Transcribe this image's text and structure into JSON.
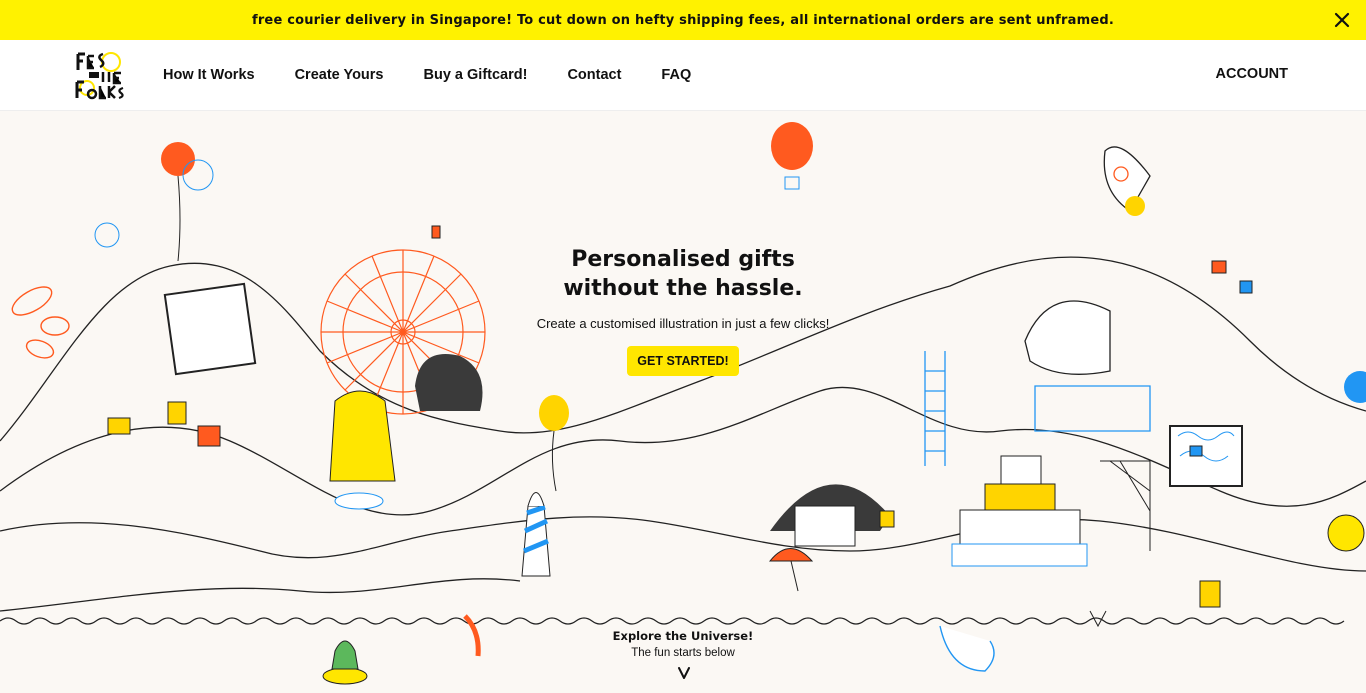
{
  "announcement": {
    "text": "free courier delivery in Singapore! To cut down on hefty shipping fees, all international orders are sent unframed.",
    "close_icon": "close-icon"
  },
  "header": {
    "logo_icon": "festive-folks-logo-icon",
    "nav": [
      {
        "label": "How It Works"
      },
      {
        "label": "Create Yours"
      },
      {
        "label": "Buy a Giftcard!"
      },
      {
        "label": "Contact"
      },
      {
        "label": "FAQ"
      }
    ],
    "account_label": "ACCOUNT"
  },
  "hero": {
    "title": "Personalised gifts without the hassle.",
    "subtitle": "Create a customised illustration in just a few clicks!",
    "cta_label": "GET STARTED!",
    "explore_title": "Explore the Universe!",
    "explore_subtitle": "The fun starts below",
    "chevron_icon": "chevron-down-icon"
  },
  "colors": {
    "announcement_bg": "#fff200",
    "cta_bg": "#ffe600",
    "accent_orange": "#ff5a1f",
    "accent_blue": "#2196f3",
    "accent_yellow": "#ffd400",
    "ink": "#111111",
    "hero_bg": "#fbf8f4"
  }
}
